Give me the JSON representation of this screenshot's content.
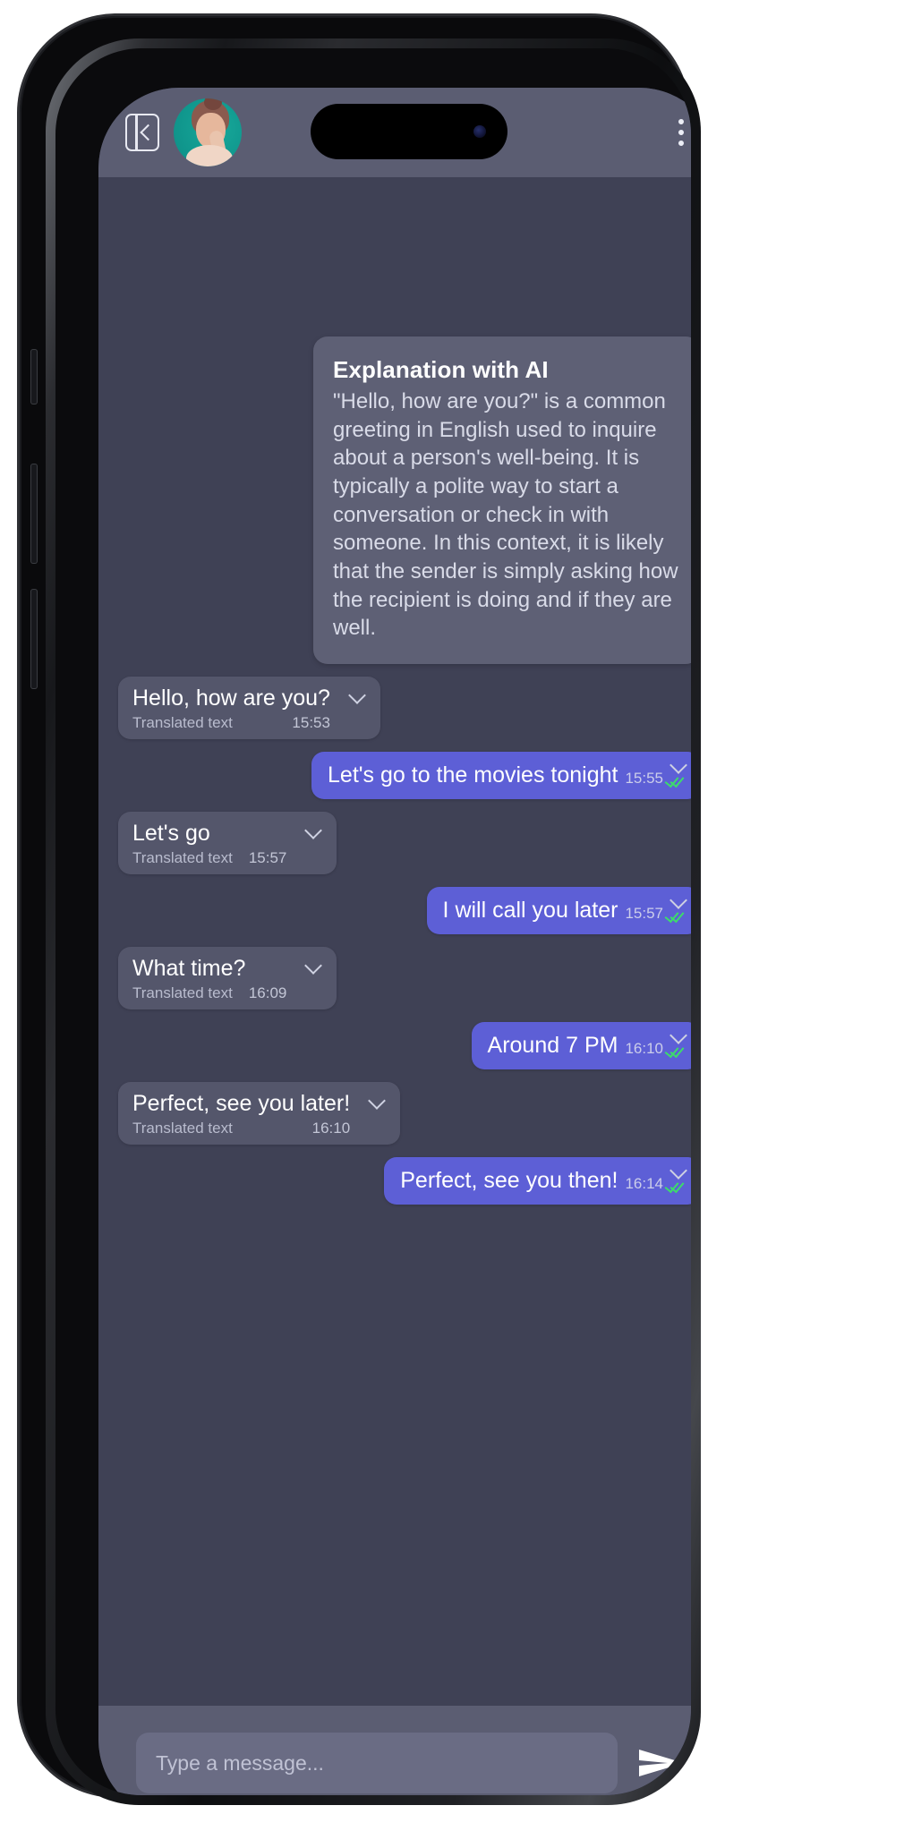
{
  "header": {
    "back_icon": "panel-collapse-icon",
    "avatar_alt": "contact-avatar",
    "menu_icon": "overflow-menu-icon",
    "camera_icon": "front-camera"
  },
  "ai_card": {
    "title": "Explanation with AI",
    "body": "\"Hello, how are you?\" is a common greeting in English used to inquire about a person's well-being. It is typically a polite way to start a conversation or check in with someone. In this context, it is likely that the sender is simply asking how the recipient is doing and if they are well."
  },
  "labels": {
    "translated": "Translated text",
    "chevron_icon": "chevron-down-icon",
    "read_receipt_icon": "double-check-icon"
  },
  "messages": [
    {
      "direction": "in",
      "text": "Hello, how are you?",
      "translated_label": "Translated text",
      "time": "15:53",
      "read": false
    },
    {
      "direction": "out",
      "text": "Let's go to the movies tonight",
      "time": "15:55",
      "read": true
    },
    {
      "direction": "in",
      "text": "Let's go",
      "translated_label": "Translated text",
      "time": "15:57",
      "read": false
    },
    {
      "direction": "out",
      "text": "I will call you later",
      "time": "15:57",
      "read": true
    },
    {
      "direction": "in",
      "text": "What time?",
      "translated_label": "Translated text",
      "time": "16:09",
      "read": false
    },
    {
      "direction": "out",
      "text": "Around 7 PM",
      "time": "16:10",
      "read": true
    },
    {
      "direction": "in",
      "text": "Perfect, see you later!",
      "translated_label": "Translated text",
      "time": "16:10",
      "read": false
    },
    {
      "direction": "out",
      "text": "Perfect, see you then!",
      "time": "16:14",
      "read": true
    }
  ],
  "composer": {
    "placeholder": "Type a message...",
    "value": "",
    "send_icon": "send-paper-plane-icon"
  },
  "colors": {
    "screen_bg": "#3f4155",
    "header_bg": "#5b5d72",
    "bubble_in": "#54566b",
    "bubble_out": "#5d5fd6",
    "ai_card_bg": "#5e6075",
    "accent_check": "#3ddc6a",
    "avatar_ring": "#12a093"
  }
}
